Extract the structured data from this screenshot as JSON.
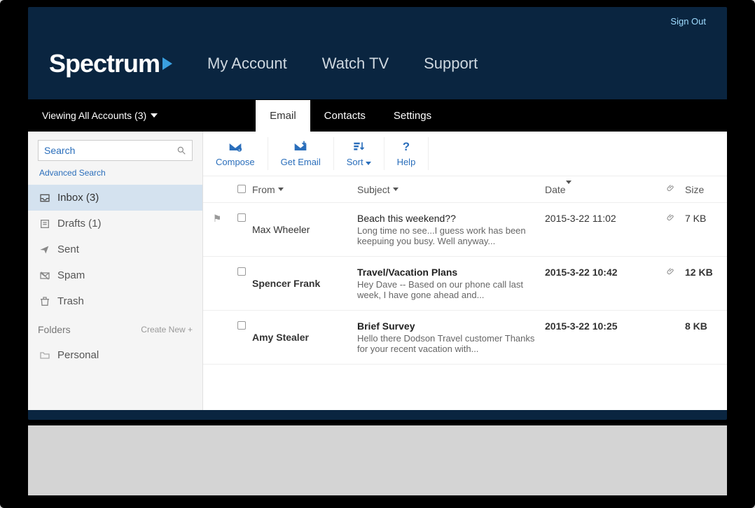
{
  "header": {
    "sign_out": "Sign Out",
    "brand": "Spectrum",
    "nav": {
      "account": "My Account",
      "watch": "Watch TV",
      "support": "Support"
    }
  },
  "subbar": {
    "account_selector": "Viewing All Accounts (3)",
    "tabs": {
      "email": "Email",
      "contacts": "Contacts",
      "settings": "Settings"
    }
  },
  "sidebar": {
    "search_placeholder": "Search",
    "advanced": "Advanced Search",
    "folders": {
      "inbox": "Inbox (3)",
      "drafts": "Drafts (1)",
      "sent": "Sent",
      "spam": "Spam",
      "trash": "Trash"
    },
    "folders_label": "Folders",
    "create_new": "Create New +",
    "personal": "Personal"
  },
  "toolbar": {
    "compose": "Compose",
    "get_email": "Get Email",
    "sort": "Sort",
    "help": "Help"
  },
  "list": {
    "headers": {
      "from": "From",
      "subject": "Subject",
      "date": "Date",
      "size": "Size"
    },
    "rows": [
      {
        "from": "Max Wheeler",
        "subject": "Beach this weekend??",
        "preview": "Long time no see...I guess work has been keepuing you busy. Well anyway...",
        "date": "2015-3-22 11:02",
        "size": "7 KB",
        "flag": true,
        "attachment": true,
        "bold": false
      },
      {
        "from": "Spencer Frank",
        "subject": "Travel/Vacation Plans",
        "preview": "Hey Dave -- Based on our phone call last week, I have gone ahead and...",
        "date": "2015-3-22 10:42",
        "size": "12 KB",
        "flag": false,
        "attachment": true,
        "bold": true
      },
      {
        "from": "Amy Stealer",
        "subject": "Brief Survey",
        "preview": "Hello there Dodson Travel customer Thanks for your recent vacation with...",
        "date": "2015-3-22 10:25",
        "size": "8 KB",
        "flag": false,
        "attachment": false,
        "bold": true
      }
    ]
  }
}
